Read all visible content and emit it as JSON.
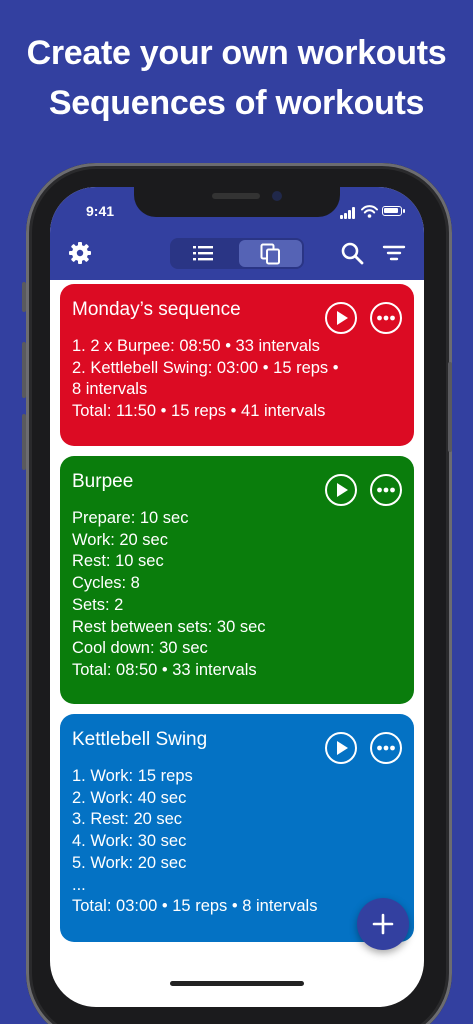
{
  "promo": {
    "line1": "Create your own workouts",
    "line2": "Sequences of workouts"
  },
  "status_bar": {
    "time": "9:41"
  },
  "toolbar": {
    "icons": [
      "gear-icon",
      "list-icon",
      "copy-icon",
      "search-icon",
      "filter-icon"
    ],
    "active_segment": "copy"
  },
  "colors": {
    "background": "#3340a0",
    "sequence_card": "#dc0b23",
    "burpee_card": "#0a7d0c",
    "kettlebell_card": "#0472c4"
  },
  "cards": [
    {
      "title": "Monday’s sequence",
      "lines": [
        "1. 2 x Burpee: 08:50 • 33 intervals",
        "2. Kettlebell Swing: 03:00 • 15 reps •",
        "8 intervals",
        "Total: 11:50 • 15 reps • 41 intervals"
      ]
    },
    {
      "title": "Burpee",
      "lines": [
        "Prepare: 10 sec",
        "Work: 20 sec",
        "Rest: 10 sec",
        "Cycles: 8",
        "Sets: 2",
        "Rest between sets: 30 sec",
        "Cool down: 30 sec",
        "Total: 08:50 • 33 intervals"
      ]
    },
    {
      "title": "Kettlebell Swing",
      "lines": [
        "1. Work: 15 reps",
        "2. Work: 40 sec",
        "3. Rest: 20 sec",
        "4. Work: 30 sec",
        "5. Work: 20 sec",
        "...",
        "Total: 03:00 • 15 reps • 8 intervals"
      ]
    }
  ],
  "fab": {
    "icon": "plus-icon"
  }
}
